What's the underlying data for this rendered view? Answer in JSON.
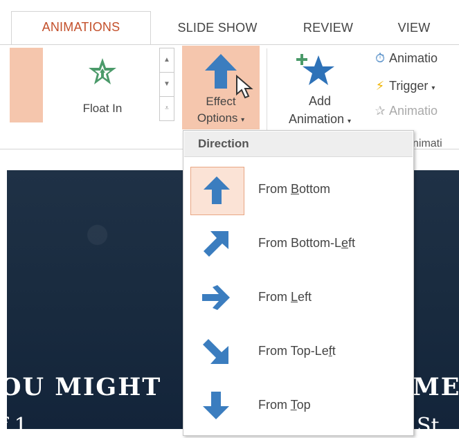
{
  "tabs": [
    {
      "label": "ANIMATIONS",
      "active": true
    },
    {
      "label": "SLIDE SHOW",
      "active": false
    },
    {
      "label": "REVIEW",
      "active": false
    },
    {
      "label": "VIEW",
      "active": false
    }
  ],
  "ribbon": {
    "gallery_item_label": "Float In",
    "gallery_item_icon": "star-float-in-icon",
    "effect_options": {
      "line1": "Effect",
      "line2": "Options",
      "icon": "arrow-up-icon"
    },
    "add_animation": {
      "line1": "Add",
      "line2": "Animation",
      "icon": "add-star-icon"
    },
    "small_commands": [
      {
        "label": "Animatio",
        "icon": "animation-pane-icon"
      },
      {
        "label": "Trigger",
        "icon": "lightning-icon"
      },
      {
        "label": "Animatio",
        "icon": "animation-painter-icon"
      }
    ],
    "group_label": "nimati"
  },
  "dropdown": {
    "header": "Direction",
    "items": [
      {
        "pre": "From ",
        "key": "B",
        "post": "ottom",
        "icon": "arrow-up-icon",
        "selected": true
      },
      {
        "pre": "From Bottom-L",
        "key": "e",
        "post": "ft",
        "icon": "arrow-up-right-icon",
        "selected": false
      },
      {
        "pre": "From ",
        "key": "L",
        "post": "eft",
        "icon": "arrow-right-icon",
        "selected": false
      },
      {
        "pre": "From Top-Le",
        "key": "f",
        "post": "t",
        "icon": "arrow-down-right-icon",
        "selected": false
      },
      {
        "pre": "From ",
        "key": "T",
        "post": "op",
        "icon": "arrow-down-icon",
        "selected": false
      }
    ]
  },
  "slide": {
    "title_left": "OU MIGHT",
    "title_right": "ME",
    "sub_left": "f  1",
    "sub_right": "St"
  },
  "colors": {
    "accent": "#c3502b",
    "selection": "#f5c6ad",
    "icon_blue": "#3b7dbf",
    "slide_bg": "#1a2c40"
  }
}
